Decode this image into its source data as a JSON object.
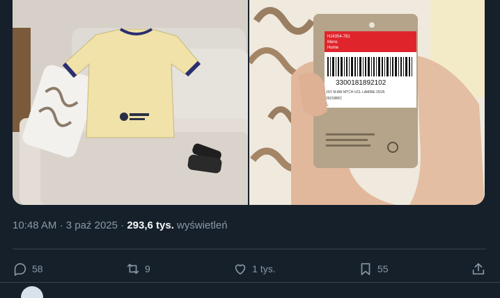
{
  "tweet": {
    "time": "10:48 AM",
    "separator1": "·",
    "date": "3 paź 2025",
    "separator2": "·",
    "views_count": "293,6 tys.",
    "views_label": "wyświetleń"
  },
  "actions": {
    "reply_count": "58",
    "retweet_count": "9",
    "like_count": "1 tys.",
    "bookmark_count": "55"
  },
  "tag": {
    "label_line1": "HJ4354-781",
    "label_line2": "Mens",
    "label_line3": "Home",
    "barcode_number": "3300181892102",
    "product_line": "JSY M AW MTCH UCL LAMINE 25/26",
    "code_line": "2621880C",
    "size": "L"
  },
  "colors": {
    "background": "#15202b",
    "muted_text": "#8b98a5",
    "divider": "#38444d",
    "tag_red": "#e0242b"
  }
}
